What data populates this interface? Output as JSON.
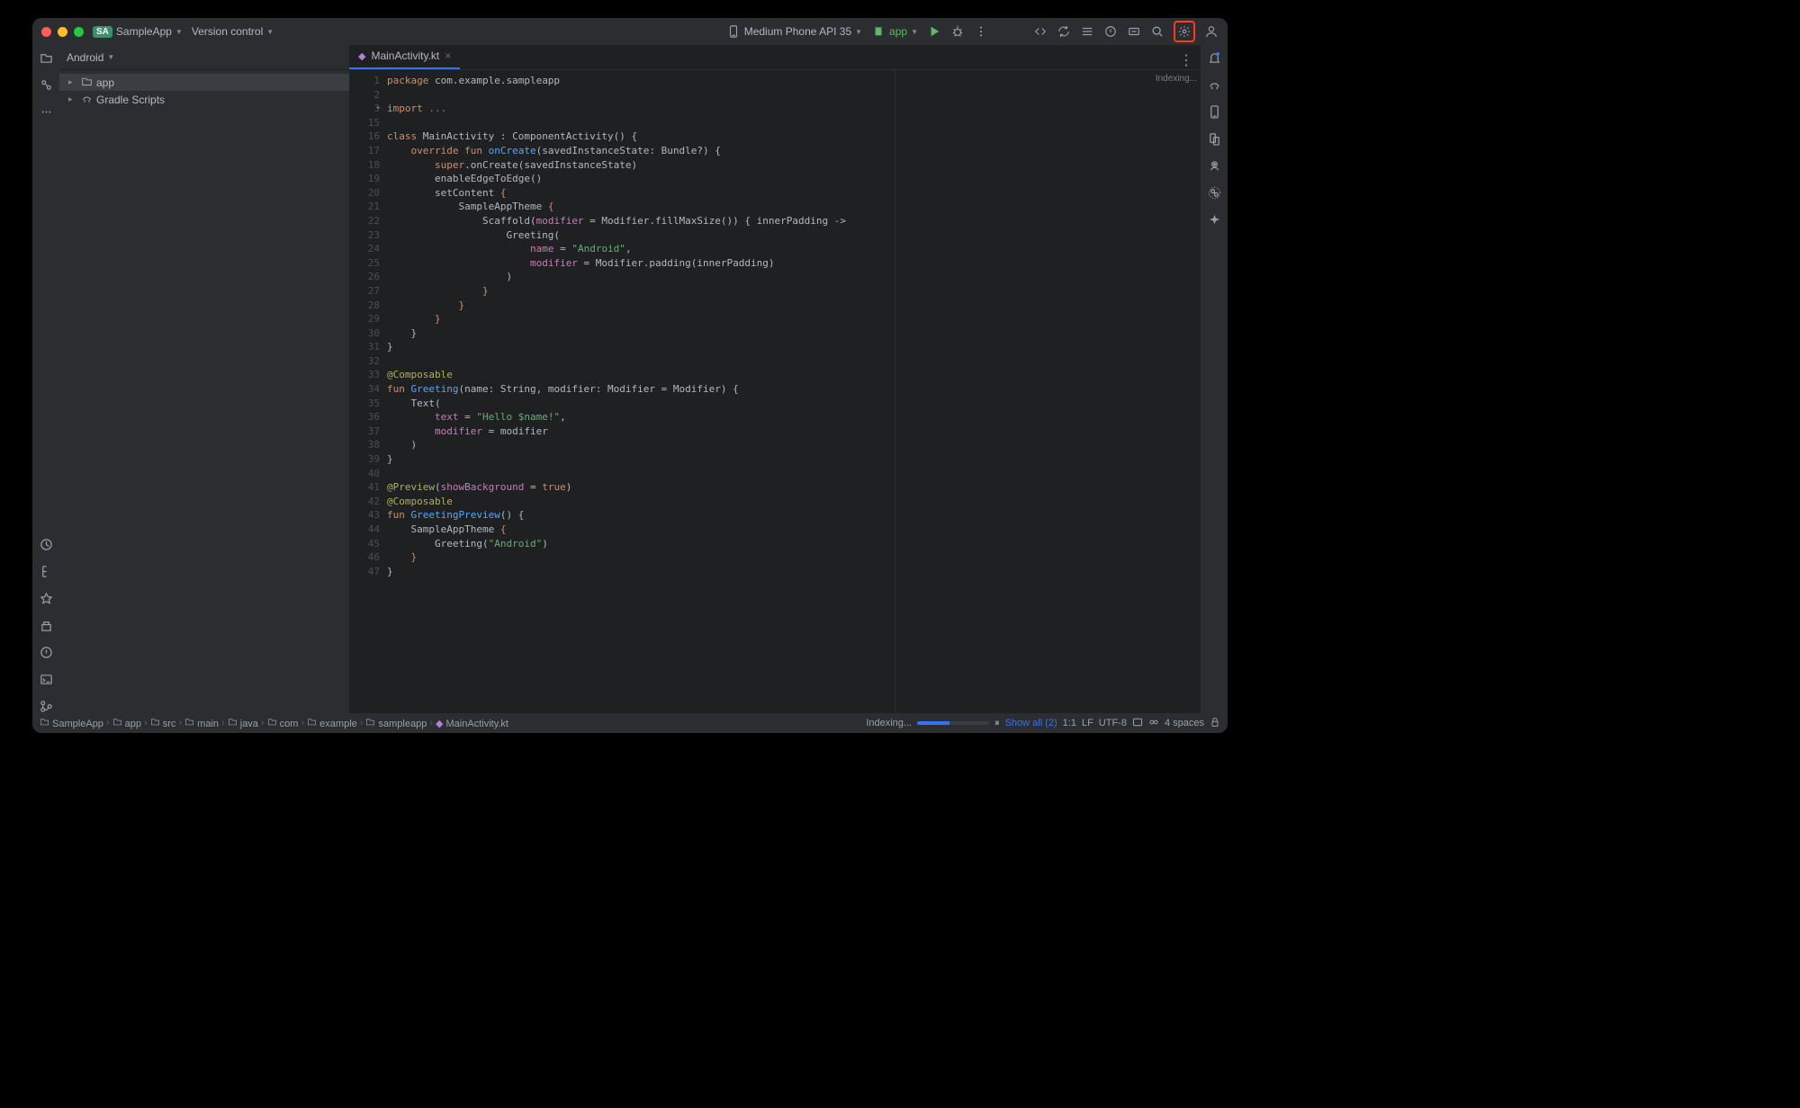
{
  "titlebar": {
    "project_short": "SA",
    "project_name": "SampleApp",
    "vcs_label": "Version control",
    "device": "Medium Phone API 35",
    "run_config": "app"
  },
  "sidebar": {
    "header": "Android",
    "items": [
      {
        "label": "app",
        "icon": "folder"
      },
      {
        "label": "Gradle Scripts",
        "icon": "gradle"
      }
    ]
  },
  "tab": {
    "filename": "MainActivity.kt"
  },
  "editor_status": "Indexing...",
  "code_lines": [
    {
      "n": 1,
      "html": "<span class='kw'>package</span> com.example.sampleapp"
    },
    {
      "n": 2,
      "html": ""
    },
    {
      "n": 3,
      "html": "<span class='kw'>import</span> <span class='com'>...</span>",
      "fold": true
    },
    {
      "n": 15,
      "html": ""
    },
    {
      "n": 16,
      "html": "<span class='kw'>class</span> MainActivity : ComponentActivity() {"
    },
    {
      "n": 17,
      "html": "    <span class='kw'>override fun</span> <span class='fn'>onCreate</span>(savedInstanceState: Bundle?) {"
    },
    {
      "n": 18,
      "html": "        <span class='kw'>super</span>.onCreate(savedInstanceState)"
    },
    {
      "n": 19,
      "html": "        enableEdgeToEdge()"
    },
    {
      "n": 20,
      "html": "        setContent <span class='kw'>{</span>"
    },
    {
      "n": 21,
      "html": "            SampleAppTheme <span class='kw'>{</span>"
    },
    {
      "n": 22,
      "html": "                Scaffold(<span class='np'>modifier</span> = Modifier.fillMaxSize()) { innerPadding ->"
    },
    {
      "n": 23,
      "html": "                    Greeting("
    },
    {
      "n": 24,
      "html": "                        <span class='np'>name</span> = <span class='str'>\"Android\"</span>,"
    },
    {
      "n": 25,
      "html": "                        <span class='np'>modifier</span> = Modifier.padding(innerPadding)"
    },
    {
      "n": 26,
      "html": "                    )"
    },
    {
      "n": 27,
      "html": "                <span class='kw'>}</span>"
    },
    {
      "n": 28,
      "html": "            <span class='kw'>}</span>"
    },
    {
      "n": 29,
      "html": "        <span class='kw'>}</span>"
    },
    {
      "n": 30,
      "html": "    }"
    },
    {
      "n": 31,
      "html": "}"
    },
    {
      "n": 32,
      "html": ""
    },
    {
      "n": 33,
      "html": "<span class='an'>@Composable</span>"
    },
    {
      "n": 34,
      "html": "<span class='kw'>fun</span> <span class='fn'>Greeting</span>(name: String, modifier: Modifier = Modifier) {"
    },
    {
      "n": 35,
      "html": "    Text("
    },
    {
      "n": 36,
      "html": "        <span class='np'>text</span> = <span class='str'>\"Hello $name!\"</span>,"
    },
    {
      "n": 37,
      "html": "        <span class='np'>modifier</span> = modifier"
    },
    {
      "n": 38,
      "html": "    )"
    },
    {
      "n": 39,
      "html": "}"
    },
    {
      "n": 40,
      "html": ""
    },
    {
      "n": 41,
      "html": "<span class='an'>@Preview</span>(<span class='np'>showBackground</span> = <span class='kw'>true</span>)"
    },
    {
      "n": 42,
      "html": "<span class='an'>@Composable</span>"
    },
    {
      "n": 43,
      "html": "<span class='kw'>fun</span> <span class='fn'>GreetingPreview</span>() {"
    },
    {
      "n": 44,
      "html": "    SampleAppTheme <span class='kw'>{</span>"
    },
    {
      "n": 45,
      "html": "        Greeting(<span class='str'>\"Android\"</span>)"
    },
    {
      "n": 46,
      "html": "    <span class='kw'>}</span>"
    },
    {
      "n": 47,
      "html": "}"
    }
  ],
  "breadcrumbs": [
    "SampleApp",
    "app",
    "src",
    "main",
    "java",
    "com",
    "example",
    "sampleapp",
    "MainActivity.kt"
  ],
  "statusbar": {
    "indexing": "Indexing...",
    "show_all": "Show all (2)",
    "pos": "1:1",
    "line_sep": "LF",
    "encoding": "UTF-8",
    "indent": "4 spaces"
  }
}
